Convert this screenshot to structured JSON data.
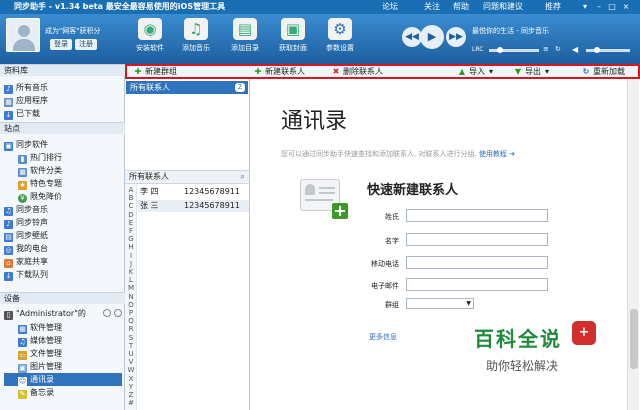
{
  "titlebar": {
    "title": "同步助手 - v1.34 beta  最安全最容易使用的iOS管理工具",
    "menu": [
      "论坛",
      "关注",
      "帮助",
      "问题和建议",
      "推荐"
    ]
  },
  "user": {
    "status": "成为\"网客\"获积分",
    "login_label": "登录",
    "register_label": "注册"
  },
  "toolbar": {
    "items": [
      {
        "label": "安装软件",
        "icon": "install-app-icon"
      },
      {
        "label": "添加音乐",
        "icon": "add-music-icon"
      },
      {
        "label": "添加目录",
        "icon": "add-folder-icon"
      },
      {
        "label": "获取封面",
        "icon": "get-cover-icon"
      },
      {
        "label": "参数设置",
        "icon": "settings-icon"
      }
    ]
  },
  "player": {
    "song": "最悦你的生活 - 同步音乐",
    "lrc_label": "LRC"
  },
  "sidebar": {
    "library_header": "资料库",
    "library_items": [
      "所有音乐",
      "应用程序",
      "已下载"
    ],
    "site_header": "站点",
    "site_items": [
      "同步软件",
      "热门排行",
      "软件分类",
      "特色专题",
      "限免降价",
      "同步音乐",
      "同步铃声",
      "同步壁纸",
      "我的电台",
      "家庭共享",
      "下载队列"
    ],
    "device_header": "设备",
    "device_name": "\"Administrator\"的",
    "device_items": [
      "软件管理",
      "媒体管理",
      "文件管理",
      "图片管理",
      "通讯录",
      "备忘录"
    ]
  },
  "actions": {
    "new_group": "新建群组",
    "new_contact": "新建联系人",
    "delete_contact": "删除联系人",
    "import": "导入",
    "export": "导出",
    "reload": "重新加载"
  },
  "groups": {
    "all_label": "所有联系人",
    "count": "2"
  },
  "contacts": {
    "header": "所有联系人",
    "alphabet": [
      "A",
      "B",
      "C",
      "D",
      "E",
      "F",
      "G",
      "H",
      "I",
      "J",
      "K",
      "L",
      "M",
      "N",
      "O",
      "P",
      "Q",
      "R",
      "S",
      "T",
      "U",
      "V",
      "W",
      "X",
      "Y",
      "Z",
      "#"
    ],
    "rows": [
      {
        "name": "李 四",
        "phone": "12345678911"
      },
      {
        "name": "张 三",
        "phone": "12345678911"
      }
    ]
  },
  "main": {
    "title": "通讯录",
    "tip": "您可以通过同步助手快速查找和添加联系人, 对联系人进行分组.",
    "tip_link": "使用教程",
    "form_title": "快速新建联系人",
    "fields": [
      "姓氏",
      "名字",
      "移动电话",
      "电子邮件",
      "群组"
    ],
    "more": "更多信息"
  },
  "watermark": {
    "line1": "百科全说",
    "line2": "助你轻松解决"
  }
}
